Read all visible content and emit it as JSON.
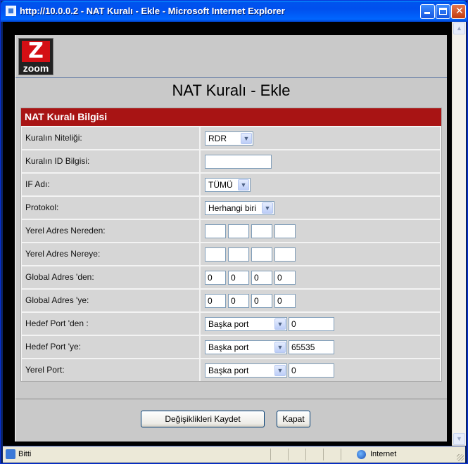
{
  "window": {
    "title": "http://10.0.0.2 - NAT Kuralı - Ekle - Microsoft Internet Explorer"
  },
  "logo": {
    "text": "zoom"
  },
  "page_title": "NAT Kuralı - Ekle",
  "section_header": "NAT Kuralı Bilgisi",
  "rows": {
    "rule_type": {
      "label": "Kuralın Niteliği:",
      "selected": "RDR"
    },
    "rule_id": {
      "label": "Kuralın ID Bilgisi:",
      "value": ""
    },
    "interface": {
      "label": "IF Adı:",
      "selected": "TÜMÜ"
    },
    "protocol": {
      "label": "Protokol:",
      "selected": "Herhangi biri"
    },
    "local_from": {
      "label": "Yerel Adres Nereden:",
      "octets": [
        "",
        "",
        "",
        ""
      ]
    },
    "local_to": {
      "label": "Yerel Adres Nereye:",
      "octets": [
        "",
        "",
        "",
        ""
      ]
    },
    "global_from": {
      "label": "Global Adres 'den:",
      "octets": [
        "0",
        "0",
        "0",
        "0"
      ]
    },
    "global_to": {
      "label": "Global Adres 'ye:",
      "octets": [
        "0",
        "0",
        "0",
        "0"
      ]
    },
    "dest_port_from": {
      "label": "Hedef Port 'den :",
      "selected": "Başka port",
      "value": "0"
    },
    "dest_port_to": {
      "label": "Hedef Port 'ye:",
      "selected": "Başka port",
      "value": "65535"
    },
    "local_port": {
      "label": "Yerel Port:",
      "selected": "Başka port",
      "value": "0"
    }
  },
  "buttons": {
    "save": "Değişiklikleri Kaydet",
    "close": "Kapat"
  },
  "statusbar": {
    "status": "Bitti",
    "zone": "Internet"
  }
}
